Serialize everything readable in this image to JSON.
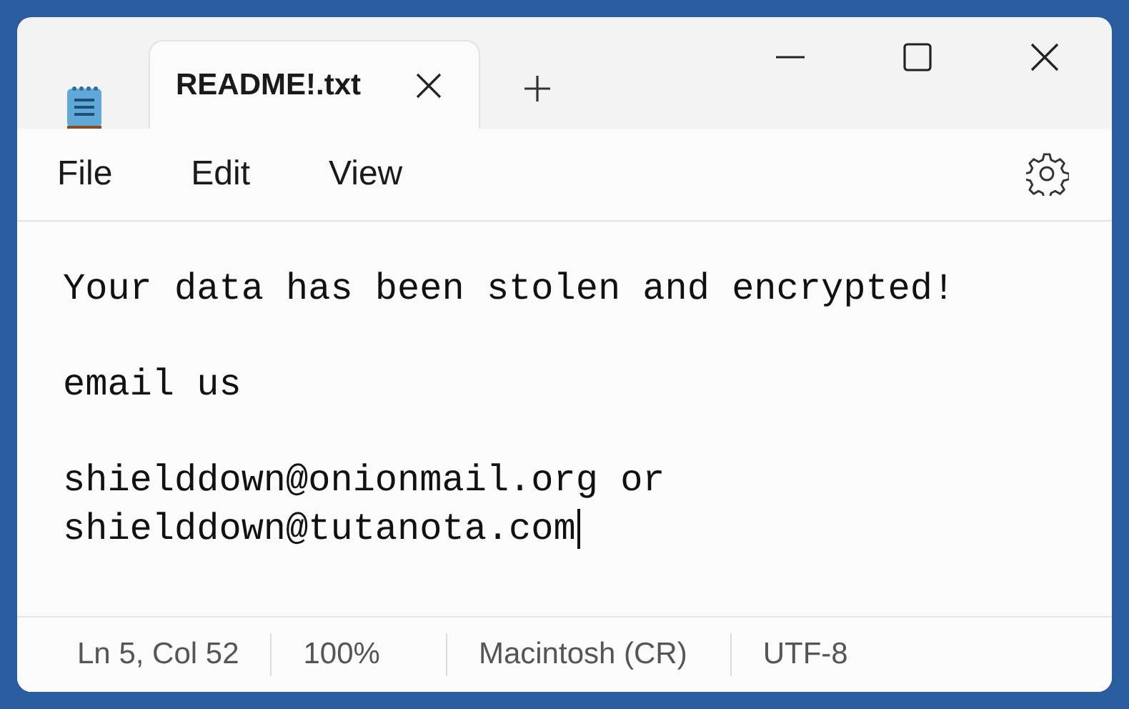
{
  "tabs": [
    {
      "label": "README!.txt",
      "selected": true
    }
  ],
  "menu": [
    "File",
    "Edit",
    "View"
  ],
  "document": {
    "paragraphs": [
      [
        "Your data has been stolen and encrypted!"
      ],
      [
        "email us"
      ],
      [
        "shielddown@onionmail.org or",
        "shielddown@tutanota.com"
      ]
    ]
  },
  "status_bar": [
    "Ln 5, Col 52",
    "100%",
    "Macintosh (CR)",
    "UTF-8"
  ]
}
